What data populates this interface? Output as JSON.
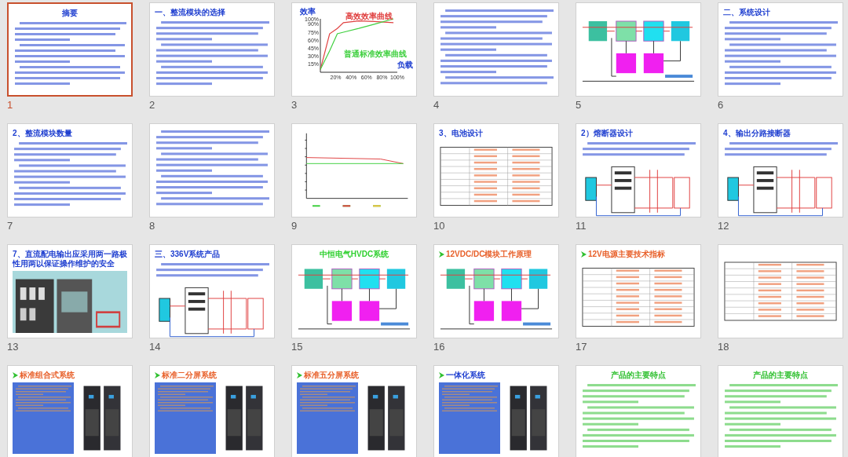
{
  "slides": [
    {
      "number": "1",
      "selected": true,
      "kind": "text",
      "title": "摘要",
      "title_centered": true,
      "color": "#1f3fd0",
      "arrow": false
    },
    {
      "number": "2",
      "selected": false,
      "kind": "text",
      "title": "一、整流模块的选择",
      "title_centered": false,
      "color": "#1f3fd0",
      "arrow": false
    },
    {
      "number": "3",
      "selected": false,
      "kind": "chart",
      "chart_data": {
        "type": "line",
        "xlabel": "负载",
        "ylabel": "效率",
        "x": [
          0,
          12,
          22,
          30,
          50,
          70,
          95
        ],
        "series": [
          {
            "name": "高效效率曲线",
            "color": "#e04040",
            "values": [
              5,
              72,
              82,
              93,
              96,
              95,
              93
            ]
          },
          {
            "name": "普通标准效率曲线",
            "color": "#40d040",
            "values": [
              5,
              40,
              72,
              75,
              82,
              90,
              100
            ]
          }
        ],
        "xlim": [
          0,
          100
        ],
        "ylim": [
          0,
          100
        ],
        "xticks": [
          {
            "value": 20,
            "label": "20%"
          },
          {
            "value": 40,
            "label": "40%"
          },
          {
            "value": 60,
            "label": "60%"
          },
          {
            "value": 80,
            "label": "80%"
          },
          {
            "value": 100,
            "label": "100%"
          }
        ],
        "yticks": [
          {
            "value": 15,
            "label": "15%"
          },
          {
            "value": 30,
            "label": "30%"
          },
          {
            "value": 45,
            "label": "45%"
          },
          {
            "value": 60,
            "label": "60%"
          },
          {
            "value": 75,
            "label": "75%"
          },
          {
            "value": 90,
            "label": "90%"
          },
          {
            "value": 100,
            "label": "100%"
          }
        ]
      }
    },
    {
      "number": "4",
      "selected": false,
      "kind": "text"
    },
    {
      "number": "5",
      "selected": false,
      "kind": "block_diagram"
    },
    {
      "number": "6",
      "selected": false,
      "kind": "text",
      "title": "二、系统设计",
      "title_centered": false,
      "color": "#1f3fd0",
      "arrow": false
    },
    {
      "number": "7",
      "selected": false,
      "kind": "text",
      "title": "2、整流模块数量",
      "title_centered": false,
      "color": "#1f3fd0",
      "arrow": false
    },
    {
      "number": "8",
      "selected": false,
      "kind": "text"
    },
    {
      "number": "9",
      "selected": false,
      "kind": "line_chart"
    },
    {
      "number": "10",
      "selected": false,
      "kind": "table",
      "title": "3、电池设计",
      "title_centered": false,
      "color": "#1f3fd0",
      "arrow": false
    },
    {
      "number": "11",
      "selected": false,
      "kind": "wiring",
      "title": "2）熔断器设计",
      "title_centered": false,
      "color": "#1f3fd0",
      "arrow": false
    },
    {
      "number": "12",
      "selected": false,
      "kind": "wiring",
      "title": "4、输出分路接断器",
      "title_centered": false,
      "color": "#1f3fd0",
      "arrow": false
    },
    {
      "number": "13",
      "selected": false,
      "title": "7、直流配电输出应采用两一路极性用两以保证操作维护的安全",
      "title_centered": false,
      "color": "#1f3fd0",
      "arrow": false
    },
    {
      "number": "14",
      "selected": false,
      "kind": "wiring",
      "title": "三、336V系统产品",
      "title_centered": false,
      "color": "#1f3fd0",
      "arrow": false
    },
    {
      "number": "15",
      "selected": false,
      "kind": "block_diagram",
      "title": "中恒电气HVDC系统",
      "title_centered": true,
      "color": "#30d030",
      "arrow": false
    },
    {
      "number": "16",
      "selected": false,
      "kind": "block_diagram",
      "title": "12VDC/DC模块工作原理",
      "title_centered": false,
      "color": "#e8602a",
      "arrow": true
    },
    {
      "number": "17",
      "selected": false,
      "kind": "table",
      "title": "12V电源主要技术指标",
      "title_centered": false,
      "color": "#e8602a",
      "arrow": true
    },
    {
      "number": "18",
      "selected": false,
      "kind": "table"
    },
    {
      "selected": false,
      "kind": "product",
      "title": "标准组合式系统",
      "title_centered": false,
      "color": "#e8602a",
      "arrow": true
    },
    {
      "selected": false,
      "kind": "product",
      "title": "标准二分屏系统",
      "title_centered": false,
      "color": "#e8602a",
      "arrow": true
    },
    {
      "selected": false,
      "kind": "product",
      "title": "标准五分屏系统",
      "title_centered": false,
      "color": "#e8602a",
      "arrow": true
    },
    {
      "selected": false,
      "kind": "product",
      "title": "一体化系统",
      "title_centered": false,
      "color": "#1f3fd0",
      "arrow": true
    },
    {
      "selected": false,
      "kind": "text",
      "title": "产品的主要特点",
      "title_centered": true,
      "color": "#30c030",
      "arrow": false
    },
    {
      "selected": false,
      "kind": "text",
      "title": "产品的主要特点",
      "title_centered": true,
      "color": "#30c030",
      "arrow": false
    }
  ]
}
